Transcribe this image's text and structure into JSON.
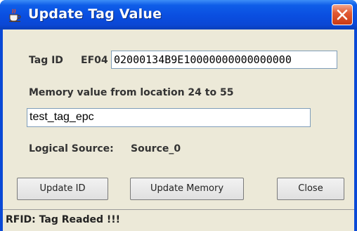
{
  "window": {
    "title": "Update Tag Value",
    "app_icon": "java-cup-icon",
    "close_icon": "close-icon"
  },
  "tag": {
    "label": "Tag ID",
    "prefix": "EF04",
    "value": "02000134B9E10000000000000000"
  },
  "memory": {
    "label": "Memory value from location 24 to 55",
    "value": "test_tag_epc"
  },
  "logical_source": {
    "label": "Logical Source:",
    "value": "Source_0"
  },
  "buttons": {
    "update_id": "Update ID",
    "update_memory": "Update Memory",
    "close": "Close"
  },
  "status": {
    "text": "RFID: Tag Readed !!!"
  },
  "colors": {
    "titlebar": "#0a4ee0",
    "close_button": "#e25b34",
    "panel": "#ece9d8",
    "field_border": "#7f9db9"
  }
}
